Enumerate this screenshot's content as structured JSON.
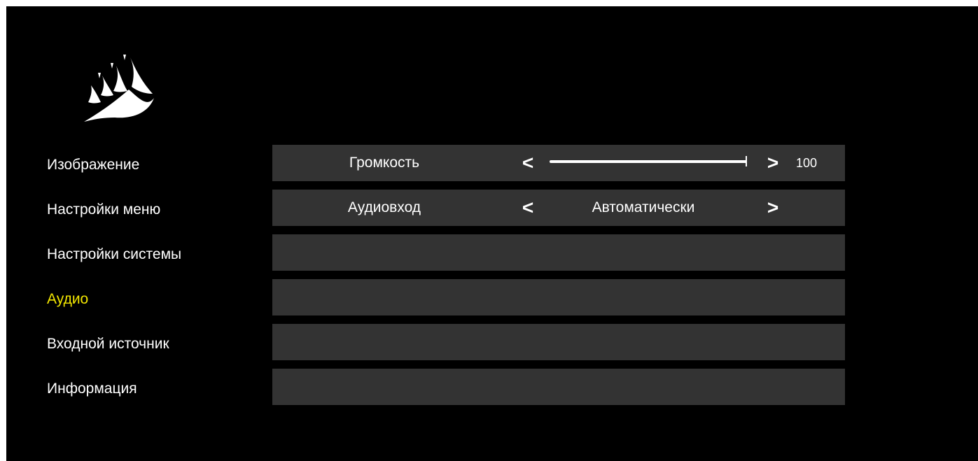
{
  "brand": {
    "logo_icon": "corsair-sails-logo-icon"
  },
  "colors": {
    "background": "#000000",
    "row_background": "#333333",
    "text": "#ffffff",
    "active": "#f2e600"
  },
  "menu": {
    "items": [
      {
        "label": "Изображение",
        "active": false
      },
      {
        "label": "Настройки меню",
        "active": false
      },
      {
        "label": "Настройки системы",
        "active": false
      },
      {
        "label": "Аудио",
        "active": true
      },
      {
        "label": "Входной источник",
        "active": false
      },
      {
        "label": "Информация",
        "active": false
      }
    ]
  },
  "settings": {
    "volume": {
      "label": "Громкость",
      "left_arrow": "<",
      "right_arrow": ">",
      "value": "100",
      "level": 1.0
    },
    "audio_input": {
      "label": "Аудиовход",
      "left_arrow": "<",
      "right_arrow": ">",
      "value": "Автоматически"
    }
  }
}
